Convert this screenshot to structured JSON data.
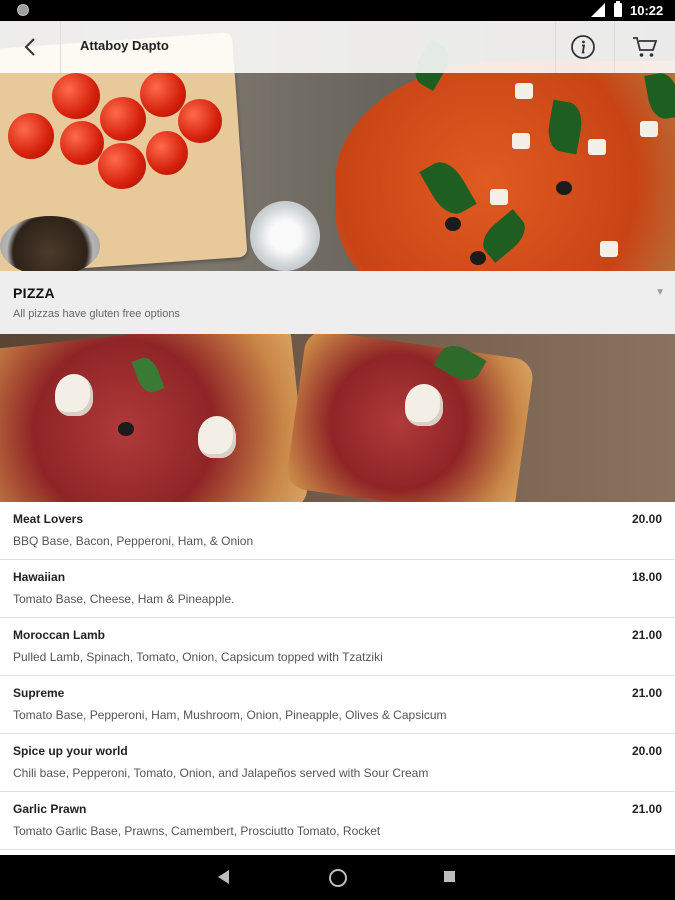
{
  "status_bar": {
    "time": "10:22"
  },
  "app_bar": {
    "title": "Attaboy Dapto",
    "back_icon": "arrow-back-icon",
    "info_icon": "info-icon",
    "cart_icon": "cart-icon"
  },
  "category": {
    "name": "PIZZA",
    "description": "All pizzas have gluten free options"
  },
  "menu_items": [
    {
      "name": "Meat Lovers",
      "description": "BBQ Base, Bacon, Pepperoni, Ham, & Onion",
      "price": "20.00"
    },
    {
      "name": "Hawaiian",
      "description": "Tomato Base, Cheese, Ham & Pineapple.",
      "price": "18.00"
    },
    {
      "name": "Moroccan Lamb",
      "description": "Pulled Lamb, Spinach, Tomato, Onion, Capsicum topped with Tzatziki",
      "price": "21.00"
    },
    {
      "name": "Supreme",
      "description": "Tomato Base, Pepperoni, Ham, Mushroom, Onion, Pineapple, Olives & Capsicum",
      "price": "21.00"
    },
    {
      "name": "Spice up your world",
      "description": "Chili base, Pepperoni, Tomato, Onion, and Jalapeños served with Sour Cream",
      "price": "20.00"
    },
    {
      "name": "Garlic Prawn",
      "description": "Tomato Garlic Base, Prawns, Camembert, Prosciutto Tomato, Rocket",
      "price": "21.00"
    }
  ],
  "colors": {
    "app_bar_bg": "#ffffff",
    "category_bg": "#eeeeee",
    "text_primary": "#222222",
    "text_secondary": "#555555"
  }
}
